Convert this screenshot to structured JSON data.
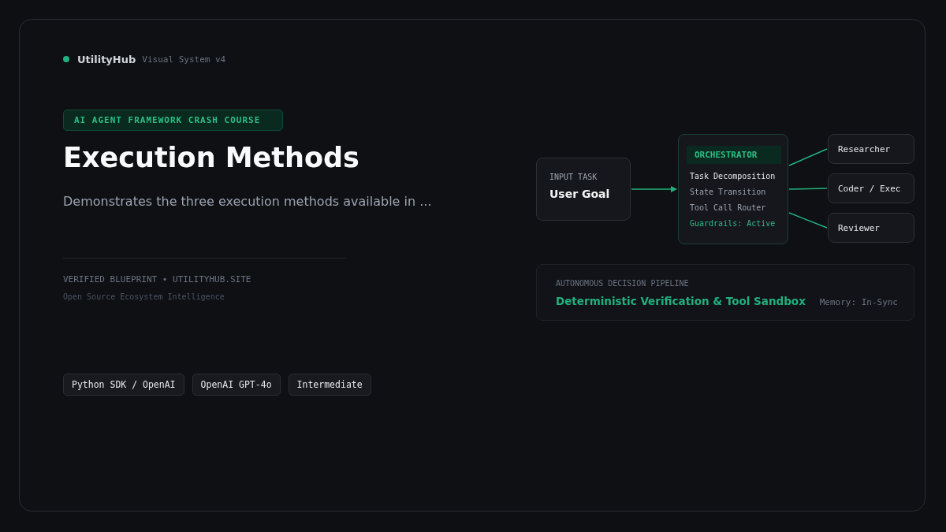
{
  "brand": {
    "name": "UtilityHub",
    "subtitle": "Visual System v4"
  },
  "course_badge": "AI AGENT FRAMEWORK CRASH COURSE",
  "title": "Execution Methods",
  "description": "Demonstrates the three execution methods available in ...",
  "footer": {
    "verified": "VERIFIED BLUEPRINT • UTILITYHUB.SITE",
    "tagline": "Open Source Ecosystem Intelligence"
  },
  "tags": [
    "Python SDK / OpenAI",
    "OpenAI GPT-4o",
    "Intermediate"
  ],
  "diagram": {
    "input": {
      "label": "INPUT TASK",
      "title": "User Goal"
    },
    "orchestrator": {
      "title": "ORCHESTRATOR",
      "steps": [
        {
          "text": "Task Decomposition",
          "kind": "primary"
        },
        {
          "text": "State Transition",
          "kind": "normal"
        },
        {
          "text": "Tool Call Router",
          "kind": "normal"
        },
        {
          "text": "Guardrails: Active",
          "kind": "status"
        }
      ]
    },
    "agents": [
      "Researcher",
      "Coder / Exec",
      "Reviewer"
    ]
  },
  "pipeline": {
    "label": "AUTONOMOUS DECISION PIPELINE",
    "title": "Deterministic Verification & Tool Sandbox",
    "status": "Memory: In-Sync"
  }
}
